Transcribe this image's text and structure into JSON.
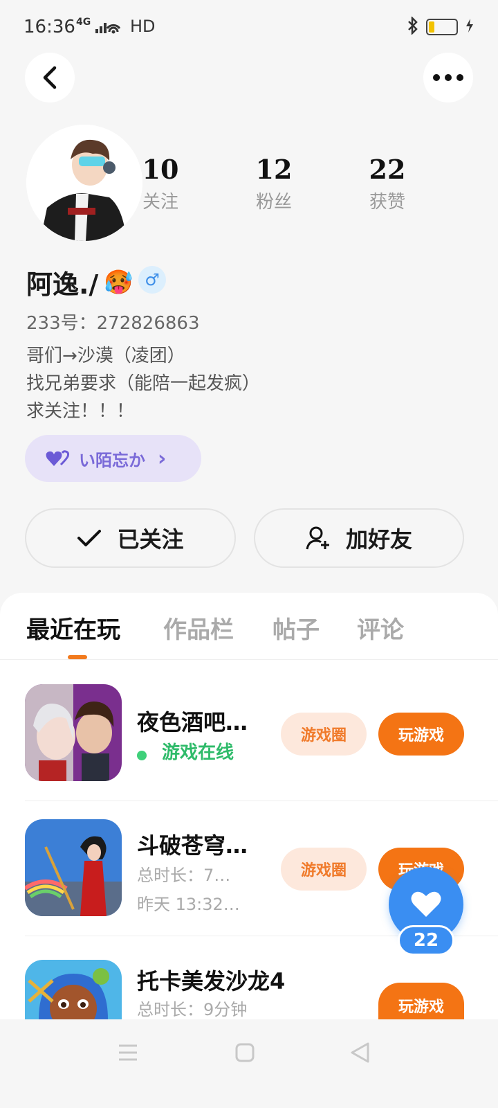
{
  "status": {
    "time": "16:36",
    "network": "4G",
    "hd": "HD"
  },
  "profile": {
    "stats": [
      {
        "value": "10",
        "label": "关注"
      },
      {
        "value": "12",
        "label": "粉丝"
      },
      {
        "value": "22",
        "label": "获赞"
      }
    ],
    "nickname": "阿逸./",
    "emoji": "🥵",
    "gender_symbol": "♂",
    "uid": "233号：272826863",
    "bio": [
      "哥们→沙漠（凌团）",
      "找兄弟要求（能陪一起发疯）",
      "求关注！！！"
    ],
    "medal": {
      "label": "い陌忘か",
      "chevron": "›"
    }
  },
  "actions": {
    "followed_label": "已关注",
    "add_friend_label": "加好友"
  },
  "tabs": [
    "最近在玩",
    "作品栏",
    "帖子",
    "评论"
  ],
  "games": [
    {
      "title": "夜色酒吧…",
      "status": "游戏在线",
      "circle_label": "游戏圈",
      "play_label": "玩游戏"
    },
    {
      "title": "斗破苍穹…",
      "duration": "总时长：7…",
      "last_played": "昨天 13:32…",
      "circle_label": "游戏圈",
      "play_label": "玩游戏"
    },
    {
      "title": "托卡美发沙龙4",
      "duration": "总时长：9分钟",
      "play_label": "玩游戏"
    }
  ],
  "like_fab": {
    "count": "22"
  },
  "colors": {
    "accent_orange": "#f47414",
    "like_blue": "#3a8ef2",
    "online_green": "#2fbb6a"
  }
}
